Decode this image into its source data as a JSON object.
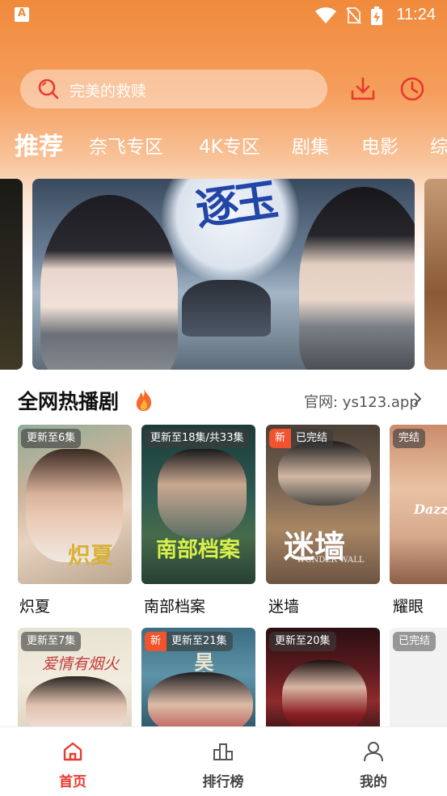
{
  "status_bar": {
    "time": "11:24"
  },
  "search": {
    "placeholder": "完美的救赎"
  },
  "tabs": [
    {
      "label": "推荐",
      "active": true
    },
    {
      "label": "奈飞专区"
    },
    {
      "label": "4K专区"
    },
    {
      "label": "剧集"
    },
    {
      "label": "电影"
    },
    {
      "label": "综"
    }
  ],
  "banner": {
    "title_art": "逐玉"
  },
  "hot_section": {
    "title": "全网热播剧",
    "more": "官网: ys123.app"
  },
  "row1": [
    {
      "name": "炽夏",
      "badge": "更新至6集",
      "is_new": false,
      "poster_text": "炽夏"
    },
    {
      "name": "南部档案",
      "badge": "更新至18集/共33集",
      "is_new": false,
      "poster_text": "南部档案"
    },
    {
      "name": "迷墙",
      "badge": "已完结",
      "is_new": true,
      "new_label": "新",
      "poster_text": "迷墙",
      "poster_sub": "WONDER WALL"
    },
    {
      "name": "耀眼",
      "badge": "完结",
      "is_new": false,
      "poster_text": "Dazzl"
    }
  ],
  "row2": [
    {
      "badge": "更新至7集",
      "is_new": false,
      "poster_text": "爱情有烟火"
    },
    {
      "badge": "更新至21集",
      "is_new": true,
      "new_label": "新",
      "poster_text": "昊离"
    },
    {
      "badge": "更新至20集",
      "is_new": false
    },
    {
      "badge": "已完结",
      "is_new": false
    }
  ],
  "bottom_nav": [
    {
      "label": "首页",
      "active": true
    },
    {
      "label": "排行榜"
    },
    {
      "label": "我的"
    }
  ],
  "colors": {
    "accent": "#e8392d",
    "header": "#f08a3c"
  }
}
